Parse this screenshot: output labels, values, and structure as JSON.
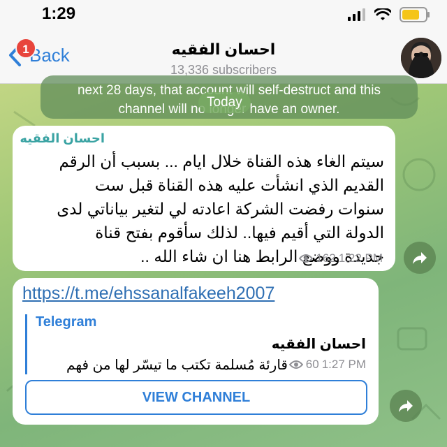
{
  "status_bar": {
    "time": "1:29"
  },
  "header": {
    "back_label": "Back",
    "back_badge": "1",
    "title": "احسان الفقيه",
    "subtitle": "13,336 subscribers"
  },
  "service_message": {
    "line1": "next 28 days, that account will self-destruct and this",
    "line2": "channel will no longer have an owner."
  },
  "date_pill": "Today",
  "messages": [
    {
      "sender": "احسان الفقيه",
      "lines": [
        "سيتم الغاء هذه القناة خلال ايام ... بسبب أن الرقم",
        "القديم الذي انشأت عليه هذه القناة قبل ست",
        "سنوات رفضت الشركة اعادته لي لتغير بياناتي لدى",
        "الدولة التي أقيم فيها.. لذلك سأقوم بفتح قناة",
        "جديدة ووضع الرابط هنا ان شاء الله .."
      ],
      "views": "162",
      "time": "1:22 PM"
    },
    {
      "link": "https://t.me/ehssanalfakeeh2007",
      "preview_site": "Telegram",
      "preview_title": "احسان الفقيه",
      "preview_desc": "قارئة مُسلمة تكتب ما تيسّر لها من فهم",
      "views": "60",
      "time": "1:27 PM",
      "button_label": "VIEW CHANNEL"
    }
  ],
  "colors": {
    "accent": "#2f7fd8",
    "sender_name": "#3aa3a3",
    "badge": "#e8453c",
    "battery": "#f5c518"
  }
}
